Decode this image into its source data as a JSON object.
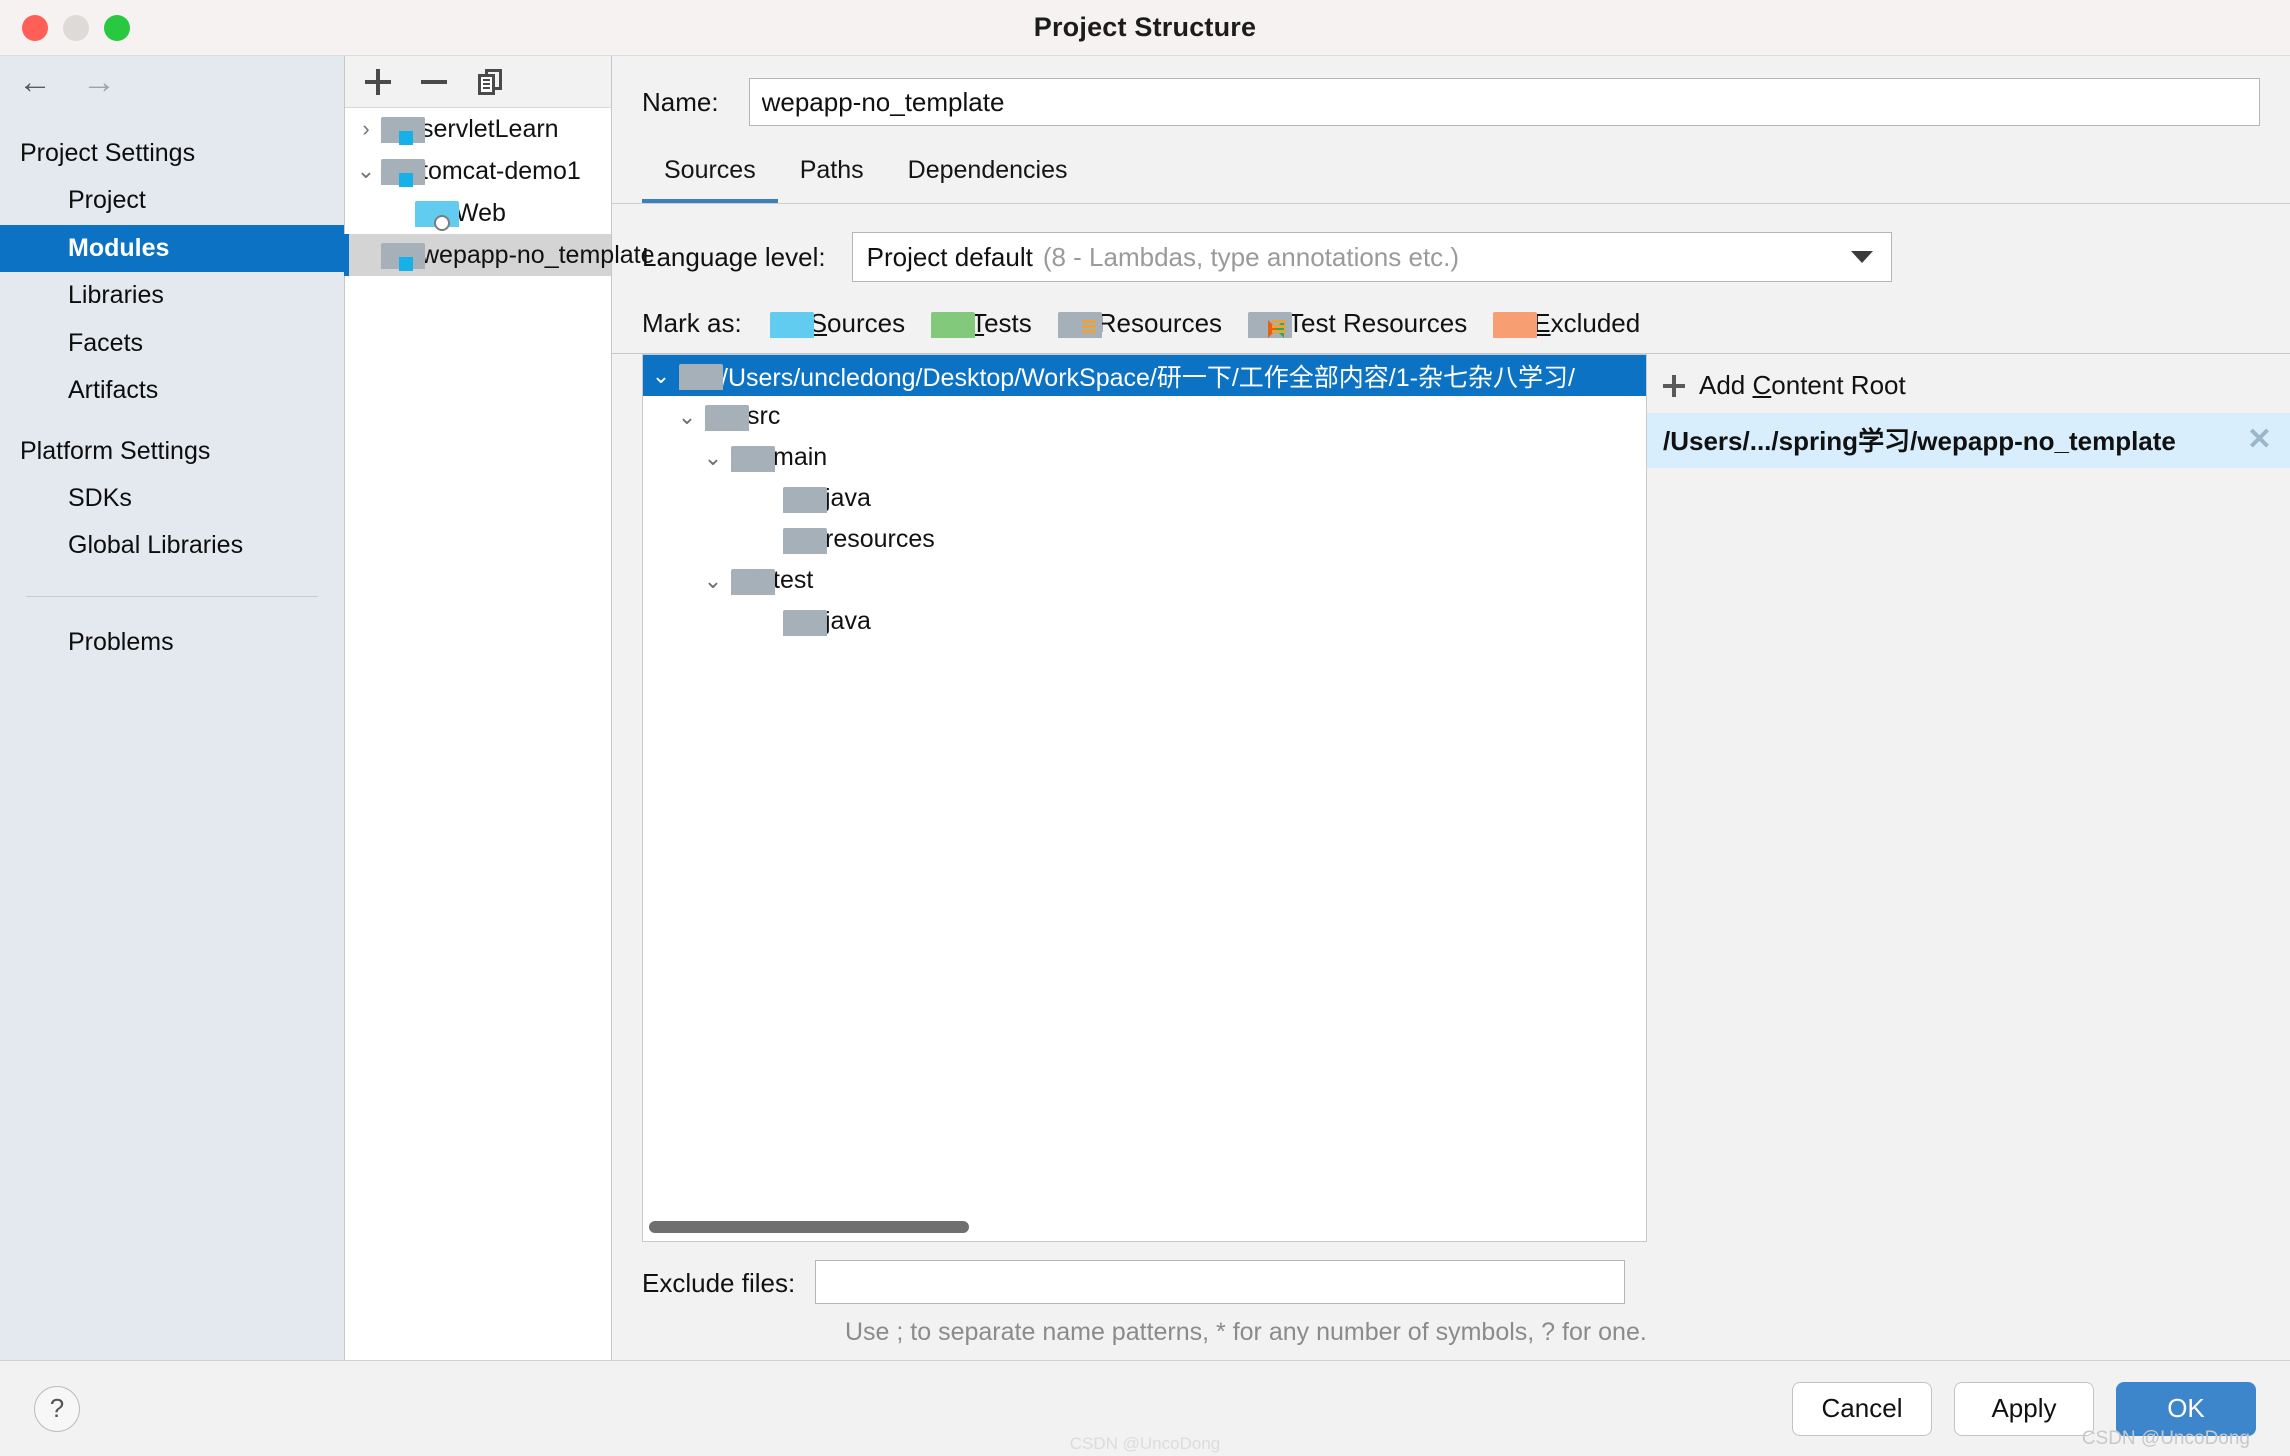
{
  "window": {
    "title": "Project Structure",
    "traffic_lights": [
      "close-red",
      "minimize-yellow",
      "zoom-green"
    ]
  },
  "sidebar": {
    "back_arrow": "←",
    "forward_arrow": "→",
    "groups": [
      {
        "label": "Project Settings",
        "items": [
          {
            "label": "Project",
            "selected": false
          },
          {
            "label": "Modules",
            "selected": true
          },
          {
            "label": "Libraries",
            "selected": false
          },
          {
            "label": "Facets",
            "selected": false
          },
          {
            "label": "Artifacts",
            "selected": false
          }
        ]
      },
      {
        "label": "Platform Settings",
        "items": [
          {
            "label": "SDKs",
            "selected": false
          },
          {
            "label": "Global Libraries",
            "selected": false
          }
        ]
      }
    ],
    "problems_label": "Problems",
    "selected_color": "#0b72c4"
  },
  "modules_panel": {
    "toolbar": {
      "add_label": "+",
      "remove_label": "−",
      "copy_label": "copy"
    },
    "tree": [
      {
        "label": "servletLearn",
        "twisty": "›",
        "depth": 0,
        "icon": "module-folder-icon",
        "selected": false
      },
      {
        "label": "tomcat-demo1",
        "twisty": "⌄",
        "depth": 0,
        "icon": "module-folder-icon",
        "selected": false
      },
      {
        "label": "Web",
        "twisty": "",
        "depth": 1,
        "icon": "web-facet-icon",
        "selected": false
      },
      {
        "label": "wepapp-no_template",
        "twisty": "",
        "depth": 0,
        "icon": "module-folder-icon",
        "selected": true
      }
    ]
  },
  "main": {
    "name_label": "Name:",
    "name_value": "wepapp-no_template",
    "name_placeholder": "",
    "tabs": [
      {
        "label": "Sources",
        "active": true
      },
      {
        "label": "Paths",
        "active": false
      },
      {
        "label": "Dependencies",
        "active": false
      }
    ],
    "language_level": {
      "label": "Language level:",
      "value": "Project default",
      "hint": "(8 - Lambdas, type annotations etc.)"
    },
    "mark_as": {
      "label": "Mark as:",
      "options": [
        {
          "label": "Sources",
          "mnemonic": "S",
          "rest": "ources",
          "icon": "folder-blue-icon",
          "color": "#62cbf0"
        },
        {
          "label": "Tests",
          "mnemonic": "T",
          "rest": "ests",
          "icon": "folder-green-icon",
          "color": "#82c97c"
        },
        {
          "label": "Resources",
          "mnemonic": "",
          "rest": "Resources",
          "icon": "folder-resources-icon",
          "color": "#a5b0b8"
        },
        {
          "label": "Test Resources",
          "mnemonic": "",
          "rest": "Test Resources",
          "icon": "folder-test-resources-icon",
          "color": "#a5b0b8"
        },
        {
          "label": "Excluded",
          "mnemonic": "E",
          "rest": "xcluded",
          "icon": "folder-orange-icon",
          "color": "#f79f73"
        }
      ]
    },
    "content_tree": [
      {
        "label": "/Users/uncledong/Desktop/WorkSpace/研一下/工作全部内容/1-杂七杂八学习/",
        "twisty": "⌄",
        "depth": 0,
        "selected": true
      },
      {
        "label": "src",
        "twisty": "⌄",
        "depth": 1,
        "selected": false
      },
      {
        "label": "main",
        "twisty": "⌄",
        "depth": 2,
        "selected": false
      },
      {
        "label": "java",
        "twisty": "",
        "depth": 3,
        "selected": false
      },
      {
        "label": "resources",
        "twisty": "",
        "depth": 3,
        "selected": false
      },
      {
        "label": "test",
        "twisty": "⌄",
        "depth": 2,
        "selected": false
      },
      {
        "label": "java",
        "twisty": "",
        "depth": 3,
        "selected": false
      }
    ],
    "right_panel": {
      "add_content_root_prefix": "Add ",
      "add_content_root_mnemonic": "C",
      "add_content_root_suffix": "ontent Root",
      "entries": [
        {
          "label": "/Users/.../spring学习/wepapp-no_template",
          "close": "✕"
        }
      ]
    },
    "exclude": {
      "label": "Exclude files:",
      "value": "",
      "placeholder": "",
      "hint": "Use ; to separate name patterns, * for any number of symbols, ? for one."
    }
  },
  "footer": {
    "help_label": "?",
    "buttons": [
      {
        "label": "Cancel",
        "style": "secondary"
      },
      {
        "label": "Apply",
        "style": "secondary"
      },
      {
        "label": "OK",
        "style": "primary"
      }
    ],
    "watermark": "CSDN @UncoDong",
    "bottom_watermark": "CSDN @UncoDong"
  }
}
